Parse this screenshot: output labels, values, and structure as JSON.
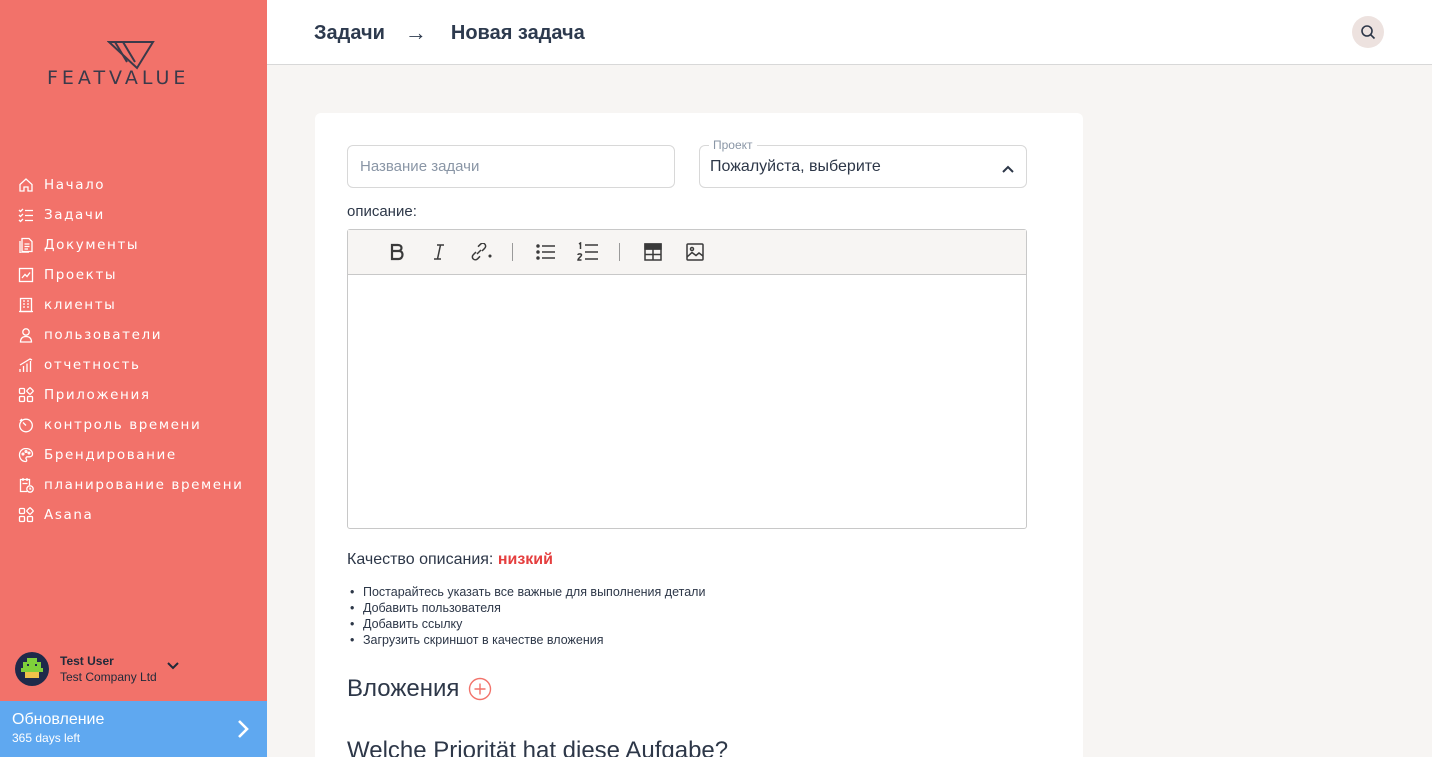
{
  "logo": {
    "text": "FEATVALUE"
  },
  "sidebar": {
    "items": [
      {
        "label": "Начало",
        "icon": "home-icon"
      },
      {
        "label": "Задачи",
        "icon": "tasks-icon"
      },
      {
        "label": "Документы",
        "icon": "documents-icon"
      },
      {
        "label": "Проекты",
        "icon": "projects-icon"
      },
      {
        "label": "клиенты",
        "icon": "clients-icon"
      },
      {
        "label": "пользователи",
        "icon": "users-icon"
      },
      {
        "label": "отчетность",
        "icon": "reports-icon"
      },
      {
        "label": "Приложения",
        "icon": "apps-icon"
      },
      {
        "label": "контроль времени",
        "icon": "timer-icon"
      },
      {
        "label": "Брендирование",
        "icon": "palette-icon"
      },
      {
        "label": "планирование времени",
        "icon": "schedule-icon"
      },
      {
        "label": "Asana",
        "icon": "apps-icon"
      }
    ],
    "user": {
      "name": "Test User",
      "company": "Test Company Ltd"
    },
    "update": {
      "title": "Обновление",
      "subtitle": "365 days left"
    }
  },
  "header": {
    "crumb_root": "Задачи",
    "crumb_arrow": "→",
    "crumb_current": "Новая задача"
  },
  "form": {
    "title_placeholder": "Название задачи",
    "title_value": "",
    "project_label": "Проект",
    "project_value": "Пожалуйста, выберите",
    "description_label": "описание:",
    "quality_label": "Качество описания:",
    "quality_value": "низкий",
    "tips": [
      "Постарайтесь указать все важные для выполнения детали",
      "Добавить пользователя",
      "Добавить ссылку",
      "Загрузить скриншот в качестве вложения"
    ],
    "attachments_title": "Вложения",
    "priority_title": "Welche Priorität hat diese Aufgabe?"
  },
  "colors": {
    "sidebar_bg": "#f2726a",
    "update_bg": "#5fa8f0",
    "quality_low": "#e53e3e",
    "accent": "#f2726a"
  }
}
